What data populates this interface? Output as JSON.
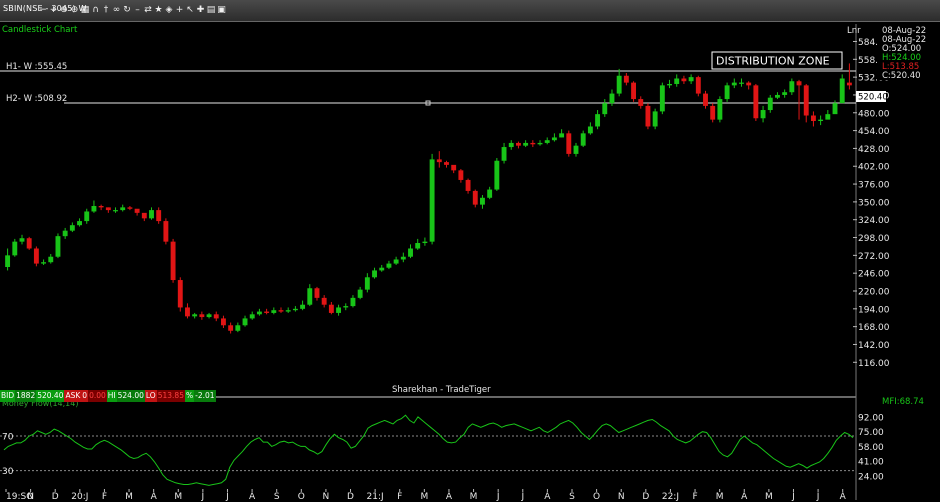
{
  "window": {
    "title": "SBIN(NSE - 3045) W",
    "toolbar_icons": [
      "minus-icon",
      "plus-icon",
      "zoom-in-icon",
      "zoom-out-icon",
      "grid-icon",
      "magnet-icon",
      "pin-icon",
      "link-icon",
      "refresh-icon",
      "dash-icon",
      "sync-icon",
      "star-icon",
      "tag-icon",
      "plus-icon",
      "cursor-icon",
      "crosshair-icon",
      "print-icon",
      "calendar-icon"
    ]
  },
  "chart_title": "Candlestick Chart",
  "scale_label": "Lnr",
  "ohlc_box": {
    "date1": "08-Aug-22",
    "date2": "08-Aug-22",
    "open": "O:524.00",
    "high": "H:524.00",
    "low": "L:513.85",
    "close": "C:520.40",
    "open_color": "#ffffff",
    "high_color": "#19d119",
    "low_color": "#e02020",
    "close_color": "#ffffff"
  },
  "annotations": {
    "zone_label": "DISTRIBUTION ZONE",
    "h1_label": "H1- W :555.45",
    "h2_label": "H2- W :508.92",
    "last_price_tag": "520.40",
    "watermark": "Sharekhan - TradeTiger",
    "mfi_label": "MFI:68.74",
    "indicator_title": "Money Flow(14,14)"
  },
  "infobar": {
    "bid_label": "BID",
    "bid_qty": "1882",
    "bid_price": "520.40",
    "ask_label": "ASK",
    "ask_qty": "0",
    "ask_price": "0.00",
    "hi_label": "HI",
    "hi_value": "524.00",
    "lo_label": "LO",
    "lo_value": "513.85",
    "pct_label": "%",
    "pct_value": "-2.01"
  },
  "chart_data": [
    {
      "type": "candlestick",
      "title": "Candlestick Chart",
      "ylim": [
        96,
        592
      ],
      "y_ticks": [
        "584.00",
        "558.00",
        "532.00",
        "506.00",
        "480.00",
        "454.00",
        "428.00",
        "402.00",
        "376.00",
        "350.00",
        "324.00",
        "298.00",
        "272.00",
        "246.00",
        "220.00",
        "194.00",
        "168.00",
        "142.00",
        "116.00"
      ],
      "horizontal_levels": [
        {
          "label": "H1- W :555.45",
          "value": 555.45
        },
        {
          "label": "H2- W :508.92",
          "value": 508.92
        }
      ],
      "x_labels": [
        "19:SO",
        "N",
        "D",
        "20:J",
        "F",
        "M",
        "A",
        "M",
        "J",
        "J",
        "A",
        "S",
        "O",
        "N",
        "D",
        "21:J",
        "F",
        "M",
        "A",
        "M",
        "J",
        "J",
        "A",
        "S",
        "O",
        "N",
        "D",
        "22:J",
        "F",
        "M",
        "A",
        "M",
        "J",
        "J",
        "A"
      ],
      "up_color": "#18c418",
      "down_color": "#e11515",
      "closes": [
        272,
        292,
        297,
        282,
        260,
        262,
        270,
        300,
        308,
        316,
        322,
        336,
        344,
        342,
        338,
        338,
        342,
        340,
        334,
        326,
        338,
        322,
        292,
        236,
        196,
        183,
        186,
        182,
        186,
        180,
        170,
        162,
        170,
        180,
        186,
        190,
        188,
        192,
        190,
        192,
        194,
        200,
        224,
        210,
        200,
        188,
        196,
        198,
        210,
        222,
        240,
        250,
        254,
        260,
        266,
        270,
        282,
        290,
        292,
        412,
        408,
        404,
        396,
        382,
        366,
        346,
        356,
        368,
        410,
        430,
        436,
        432,
        436,
        434,
        436,
        440,
        444,
        450,
        420,
        432,
        450,
        460,
        478,
        494,
        508,
        534,
        524,
        500,
        490,
        460,
        482,
        520,
        522,
        530,
        526,
        532,
        508,
        490,
        470,
        500,
        520,
        524,
        524,
        520,
        472,
        484,
        502,
        506,
        510,
        526,
        520,
        476,
        468,
        470,
        478,
        494,
        530,
        520
      ],
      "opens": [
        255,
        272,
        292,
        297,
        282,
        260,
        262,
        270,
        300,
        308,
        316,
        322,
        336,
        344,
        342,
        338,
        338,
        342,
        340,
        334,
        326,
        338,
        322,
        292,
        236,
        196,
        183,
        186,
        182,
        186,
        180,
        170,
        162,
        170,
        180,
        186,
        190,
        188,
        192,
        190,
        192,
        194,
        200,
        224,
        210,
        200,
        188,
        196,
        198,
        210,
        222,
        240,
        250,
        254,
        260,
        266,
        270,
        282,
        290,
        292,
        412,
        408,
        404,
        396,
        382,
        366,
        346,
        356,
        368,
        410,
        430,
        436,
        432,
        436,
        434,
        436,
        440,
        444,
        450,
        420,
        432,
        450,
        460,
        478,
        494,
        508,
        534,
        524,
        500,
        490,
        460,
        482,
        520,
        522,
        530,
        526,
        532,
        508,
        490,
        470,
        500,
        520,
        524,
        524,
        520,
        472,
        484,
        502,
        506,
        510,
        526,
        520,
        476,
        468,
        470,
        478,
        494,
        524
      ],
      "highs": [
        282,
        296,
        302,
        299,
        285,
        266,
        274,
        304,
        312,
        320,
        326,
        340,
        352,
        346,
        342,
        342,
        346,
        344,
        338,
        330,
        342,
        342,
        326,
        296,
        240,
        202,
        188,
        190,
        188,
        190,
        184,
        174,
        174,
        184,
        190,
        194,
        194,
        196,
        196,
        196,
        198,
        206,
        230,
        226,
        214,
        204,
        200,
        202,
        214,
        226,
        246,
        254,
        258,
        264,
        270,
        276,
        288,
        296,
        298,
        420,
        424,
        410,
        402,
        398,
        384,
        368,
        360,
        372,
        414,
        436,
        440,
        438,
        440,
        440,
        440,
        444,
        450,
        456,
        454,
        436,
        454,
        466,
        484,
        500,
        514,
        544,
        538,
        526,
        504,
        494,
        486,
        524,
        528,
        536,
        534,
        536,
        534,
        512,
        494,
        504,
        524,
        530,
        530,
        526,
        522,
        490,
        506,
        510,
        514,
        530,
        528,
        522,
        482,
        476,
        484,
        498,
        536,
        552
      ],
      "lows": [
        250,
        270,
        288,
        280,
        256,
        258,
        260,
        268,
        296,
        306,
        314,
        318,
        334,
        338,
        334,
        334,
        336,
        338,
        330,
        322,
        324,
        318,
        288,
        232,
        190,
        180,
        180,
        178,
        180,
        176,
        166,
        158,
        160,
        168,
        178,
        184,
        186,
        186,
        188,
        188,
        190,
        192,
        198,
        206,
        196,
        186,
        184,
        192,
        196,
        208,
        218,
        238,
        248,
        252,
        258,
        262,
        268,
        280,
        286,
        288,
        400,
        400,
        392,
        378,
        362,
        342,
        340,
        354,
        366,
        406,
        426,
        428,
        430,
        430,
        432,
        434,
        438,
        444,
        416,
        416,
        430,
        448,
        456,
        474,
        490,
        504,
        520,
        496,
        486,
        456,
        456,
        478,
        516,
        518,
        522,
        522,
        504,
        486,
        466,
        466,
        496,
        516,
        518,
        514,
        468,
        466,
        480,
        500,
        502,
        506,
        470,
        466,
        460,
        462,
        472,
        490,
        514,
        514
      ]
    },
    {
      "type": "line",
      "title": "Money Flow(14,14)",
      "series_name": "MFI",
      "last_value": 68.74,
      "ylim": [
        10,
        100
      ],
      "y_ticks": [
        "92.00",
        "75.00",
        "58.00",
        "41.00",
        "24.00"
      ],
      "reference_lines": [
        {
          "label": "70",
          "value": 70
        },
        {
          "label": "30",
          "value": 30
        }
      ],
      "line_color": "#19c419",
      "values": [
        54,
        58,
        60,
        62,
        62,
        65,
        70,
        72,
        76,
        74,
        72,
        74,
        78,
        76,
        73,
        70,
        67,
        63,
        60,
        57,
        55,
        55,
        60,
        63,
        65,
        63,
        60,
        57,
        54,
        50,
        46,
        44,
        45,
        48,
        50,
        46,
        40,
        33,
        25,
        20,
        18,
        16,
        15,
        14,
        14,
        15,
        16,
        15,
        14,
        13,
        14,
        15,
        16,
        20,
        34,
        42,
        47,
        52,
        58,
        63,
        66,
        68,
        63,
        63,
        58,
        60,
        63,
        64,
        62,
        63,
        60,
        58,
        58,
        54,
        52,
        49,
        52,
        60,
        67,
        72,
        68,
        66,
        63,
        56,
        58,
        64,
        70,
        79,
        82,
        84,
        86,
        88,
        86,
        84,
        88,
        90,
        94,
        88,
        85,
        92,
        88,
        84,
        80,
        76,
        72,
        67,
        63,
        62,
        63,
        68,
        72,
        80,
        84,
        82,
        80,
        82,
        84,
        85,
        83,
        80,
        82,
        83,
        84,
        82,
        80,
        78,
        76,
        78,
        80,
        76,
        74,
        77,
        80,
        84,
        86,
        88,
        85,
        80,
        74,
        70,
        66,
        71,
        77,
        82,
        84,
        82,
        78,
        74,
        76,
        78,
        80,
        82,
        84,
        86,
        88,
        89,
        86,
        82,
        79,
        76,
        70,
        66,
        64,
        62,
        64,
        68,
        72,
        75,
        74,
        68,
        60,
        52,
        48,
        46,
        50,
        58,
        66,
        70,
        66,
        62,
        60,
        56,
        52,
        48,
        44,
        41,
        38,
        35,
        34,
        36,
        38,
        36,
        33,
        36,
        38,
        40,
        44,
        50,
        57,
        65,
        70,
        74,
        72,
        68
      ]
    }
  ]
}
